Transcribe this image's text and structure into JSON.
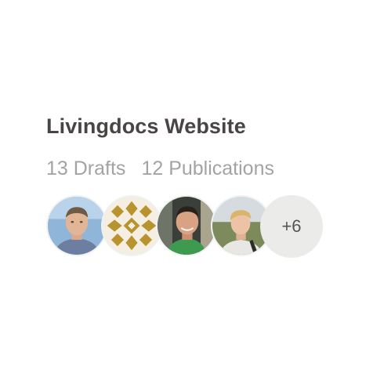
{
  "project": {
    "title": "Livingdocs Website",
    "drafts": "13 Drafts",
    "publications": "12 Publications"
  },
  "members": {
    "avatars": [
      {
        "name": "avatar-1",
        "icon": "person-photo"
      },
      {
        "name": "avatar-2",
        "icon": "gold-pattern-logo"
      },
      {
        "name": "avatar-3",
        "icon": "person-photo"
      },
      {
        "name": "avatar-4",
        "icon": "person-photo"
      }
    ],
    "more_count": "+6"
  },
  "colors": {
    "title": "#4a4545",
    "stats": "#a3a3a3",
    "more_bg": "#ebebe9",
    "pattern_gold": "#b8932e"
  }
}
